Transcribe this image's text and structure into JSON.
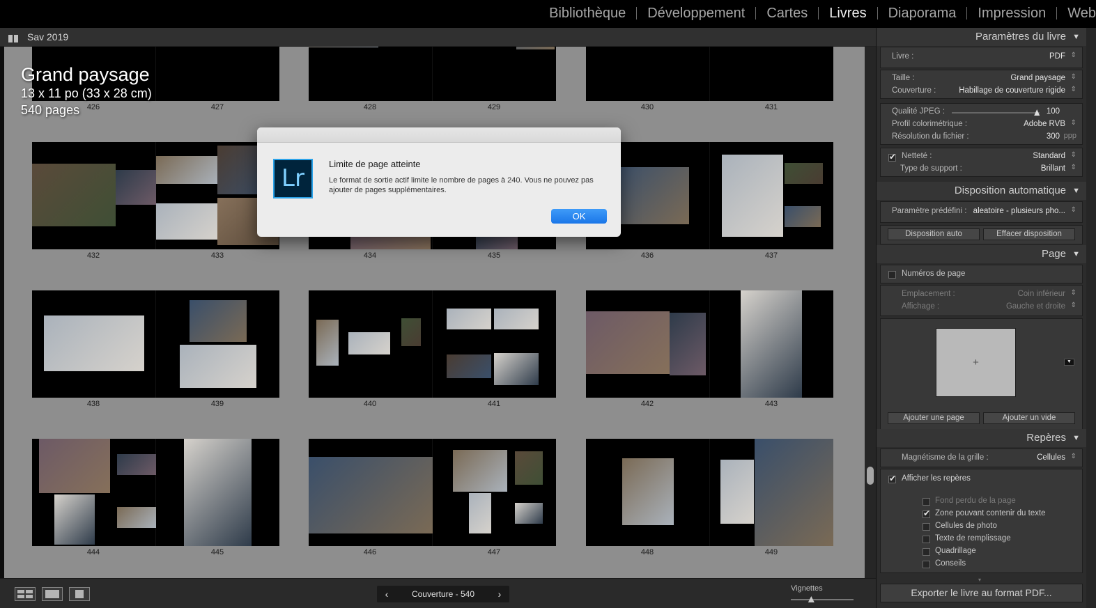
{
  "modules": [
    "Bibliothèque",
    "Développement",
    "Cartes",
    "Livres",
    "Diaporama",
    "Impression",
    "Web"
  ],
  "active_module": "Livres",
  "collection": {
    "title": "Sav 2019"
  },
  "book_info": {
    "title": "Grand paysage",
    "size": "13 x 11 po (33 x 28 cm)",
    "pages": "540 pages"
  },
  "spreads": [
    {
      "left": "426",
      "right": "427"
    },
    {
      "left": "428",
      "right": "429"
    },
    {
      "left": "430",
      "right": "431"
    },
    {
      "left": "432",
      "right": "433"
    },
    {
      "left": "434",
      "right": "435"
    },
    {
      "left": "436",
      "right": "437"
    },
    {
      "left": "438",
      "right": "439"
    },
    {
      "left": "440",
      "right": "441"
    },
    {
      "left": "442",
      "right": "443"
    },
    {
      "left": "444",
      "right": "445"
    },
    {
      "left": "446",
      "right": "447"
    },
    {
      "left": "448",
      "right": "449"
    }
  ],
  "toolbar": {
    "pager_label": "Couverture - 540",
    "prev": "‹",
    "next": "›",
    "thumbnails_label": "Vignettes",
    "thumbnails_level": 0.32
  },
  "panel": {
    "book_settings": {
      "title": "Paramètres du livre",
      "livre_label": "Livre :",
      "livre_value": "PDF",
      "taille_label": "Taille :",
      "taille_value": "Grand paysage",
      "couverture_label": "Couverture :",
      "couverture_value": "Habillage de couverture rigide",
      "jpeg_label": "Qualité JPEG :",
      "jpeg_value": "100",
      "jpeg_level": 0.97,
      "profil_label": "Profil colorimétrique :",
      "profil_value": "Adobe RVB",
      "resolution_label": "Résolution du fichier :",
      "resolution_value": "300",
      "resolution_unit": "ppp",
      "nettete_label": "Netteté :",
      "nettete_value": "Standard",
      "nettete_checked": true,
      "support_label": "Type de support :",
      "support_value": "Brillant"
    },
    "auto_layout": {
      "title": "Disposition automatique",
      "preset_label": "Paramètre prédéfini :",
      "preset_value": "aleatoire - plusieurs pho...",
      "auto_btn": "Disposition auto",
      "clear_btn": "Effacer disposition"
    },
    "page": {
      "title": "Page",
      "page_numbers_label": "Numéros de page",
      "emplacement_label": "Emplacement :",
      "emplacement_value": "Coin inférieur",
      "affichage_label": "Affichage :",
      "affichage_value": "Gauche et droite",
      "plus": "+",
      "add_page_btn": "Ajouter une page",
      "add_blank_btn": "Ajouter un vide"
    },
    "guides": {
      "title": "Repères",
      "grid_snap_label": "Magnétisme de la grille :",
      "grid_snap_value": "Cellules",
      "show_guides_label": "Afficher les repères",
      "items": [
        {
          "label": "Fond perdu de la page",
          "checked": false,
          "dim": true
        },
        {
          "label": "Zone pouvant contenir du texte",
          "checked": true,
          "dim": false
        },
        {
          "label": "Cellules de photo",
          "checked": false,
          "dim": false
        },
        {
          "label": "Texte de remplissage",
          "checked": false,
          "dim": false
        },
        {
          "label": "Quadrillage",
          "checked": false,
          "dim": false
        },
        {
          "label": "Conseils",
          "checked": false,
          "dim": false
        }
      ]
    },
    "export_btn": "Exporter le livre au format PDF..."
  },
  "dialog": {
    "logo": "Lr",
    "title": "Limite de page atteinte",
    "message": "Le format de sortie actif limite le nombre de pages à 240. Vous ne pouvez pas ajouter de pages supplémentaires.",
    "ok": "OK"
  },
  "colors": {
    "accent_blue": "#1a76e8",
    "canvas_gray": "#8e8e8e",
    "panel_bg": "#2c2c2c",
    "lr_blue": "#2ba3e9"
  }
}
